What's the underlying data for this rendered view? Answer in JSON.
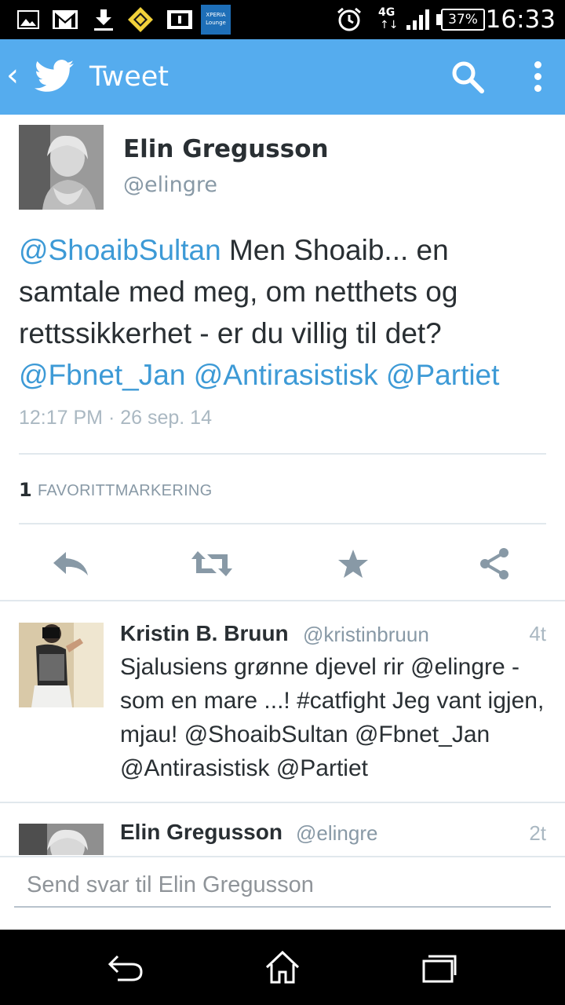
{
  "status_bar": {
    "time": "16:33",
    "battery": "37%",
    "network": "4G",
    "network_arrows": "↑↓",
    "icons": [
      "gallery-icon",
      "gmail-icon",
      "download-icon",
      "app-icon",
      "sim-icon",
      "xperia-lounge-icon",
      "alarm-icon",
      "signal-icon"
    ]
  },
  "app_bar": {
    "back": "‹",
    "title": "Tweet"
  },
  "tweet": {
    "author_name": "Elin Gregusson",
    "author_handle": "@elingre",
    "text_parts": {
      "m1": "@ShoaibSultan",
      "t1": " Men Shoaib... en samtale med meg, om netthets og rettssikkerhet - er du villig til det? ",
      "m2": "@Fbnet_Jan",
      "t2": " ",
      "m3": "@Antirasistisk",
      "t3": " ",
      "m4": "@Partiet"
    },
    "timestamp": "12:17 PM · 26 sep. 14",
    "favorite_count": "1",
    "favorite_label": "FAVORITTMARKERING",
    "actions": [
      "reply-icon",
      "retweet-icon",
      "favorite-icon",
      "share-icon"
    ]
  },
  "replies": [
    {
      "name": "Kristin B. Bruun",
      "handle": "@kristinbruun",
      "age": "4t",
      "text": "Sjalusiens grønne djevel rir @elingre - som en mare ...! #catfight  Jeg vant igjen, mjau!  @ShoaibSultan @Fbnet_Jan @Antirasistisk @Partiet"
    },
    {
      "name": "Elin Gregusson",
      "handle": "@elingre",
      "age": "2t",
      "text": ""
    }
  ],
  "compose": {
    "placeholder": "Send svar til Elin Gregusson"
  },
  "colors": {
    "brand": "#55acee",
    "link": "#3d9ad6",
    "text": "#292f33",
    "muted": "#8899a6"
  }
}
